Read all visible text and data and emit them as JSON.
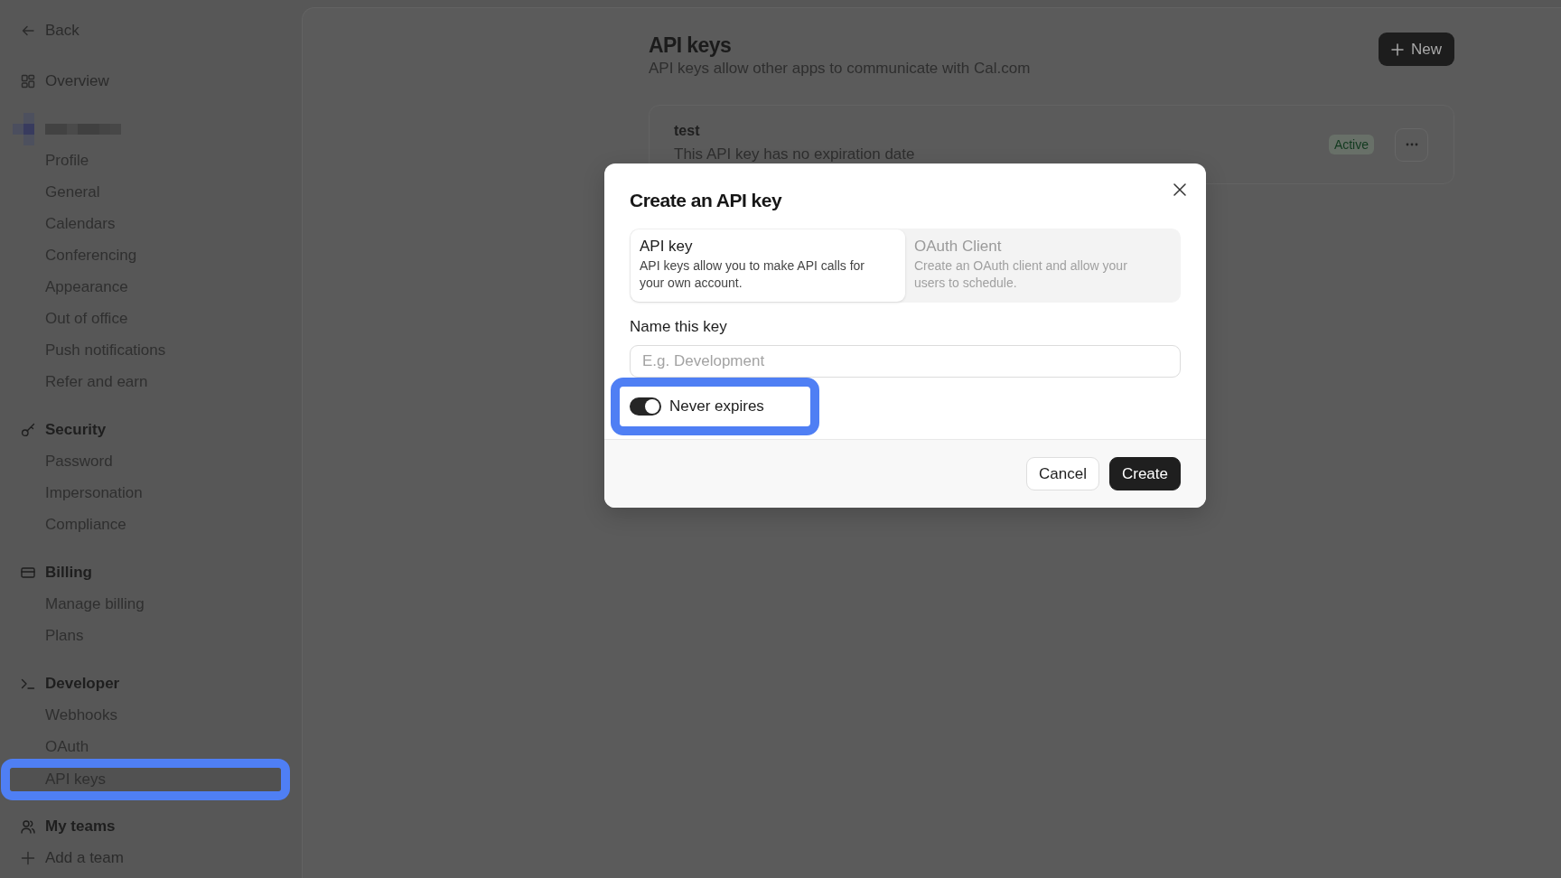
{
  "sidebar": {
    "nav": [
      {
        "kind": "back",
        "label": "Back"
      },
      {
        "kind": "overview",
        "label": "Overview"
      },
      {
        "kind": "account",
        "items": [
          {
            "label": "Profile",
            "selected": false,
            "highlighted": false
          },
          {
            "label": "General",
            "selected": false,
            "highlighted": false
          },
          {
            "label": "Calendars",
            "selected": false,
            "highlighted": false
          },
          {
            "label": "Conferencing",
            "selected": false,
            "highlighted": false
          },
          {
            "label": "Appearance",
            "selected": false,
            "highlighted": false
          },
          {
            "label": "Out of office",
            "selected": false,
            "highlighted": false
          },
          {
            "label": "Push notifications",
            "selected": false,
            "highlighted": false
          },
          {
            "label": "Refer and earn",
            "selected": false,
            "highlighted": false
          }
        ]
      },
      {
        "kind": "security",
        "label": "Security",
        "items": [
          {
            "label": "Password",
            "selected": false,
            "highlighted": false
          },
          {
            "label": "Impersonation",
            "selected": false,
            "highlighted": false
          },
          {
            "label": "Compliance",
            "selected": false,
            "highlighted": false
          }
        ]
      },
      {
        "kind": "billing",
        "label": "Billing",
        "items": [
          {
            "label": "Manage billing",
            "selected": false,
            "highlighted": false
          },
          {
            "label": "Plans",
            "selected": false,
            "highlighted": false
          }
        ]
      },
      {
        "kind": "developer",
        "label": "Developer",
        "items": [
          {
            "label": "Webhooks",
            "selected": false,
            "highlighted": false
          },
          {
            "label": "OAuth",
            "selected": false,
            "highlighted": false
          },
          {
            "label": "API keys",
            "selected": true,
            "highlighted": true
          }
        ]
      },
      {
        "kind": "teams",
        "label": "My teams"
      },
      {
        "kind": "add",
        "label": "Add a team"
      }
    ]
  },
  "page": {
    "title": "API keys",
    "subtitle": "API keys allow other apps to communicate with Cal.com",
    "new_button": "New",
    "keys": [
      {
        "name": "test",
        "expiry": "This API key has no expiration date",
        "status": "Active"
      }
    ]
  },
  "dialog": {
    "title": "Create an API key",
    "tabs": [
      {
        "title": "API key",
        "description": "API keys allow you to make API calls for your own account.",
        "selected": true
      },
      {
        "title": "OAuth Client",
        "description": "Create an OAuth client and allow your users to schedule.",
        "selected": false
      }
    ],
    "name_field": {
      "label": "Name this key",
      "placeholder": "E.g. Development"
    },
    "never_expires": {
      "label": "Never expires",
      "on": true,
      "highlighted": true
    },
    "buttons": [
      {
        "label": "Cancel",
        "kind": "secondary"
      },
      {
        "label": "Create",
        "kind": "primary"
      }
    ]
  }
}
